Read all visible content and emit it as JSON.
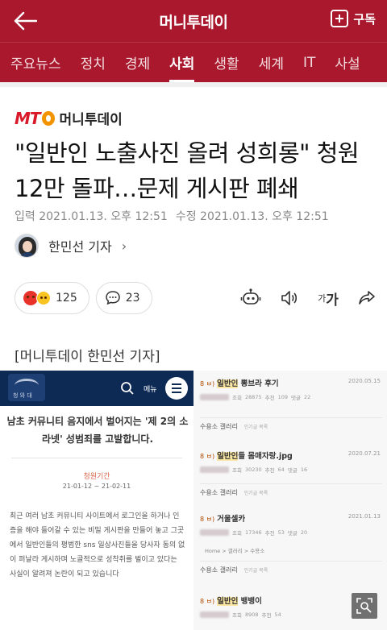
{
  "header": {
    "title": "머니투데이",
    "subscribe_label": "구독",
    "back_icon": "arrow-left-icon",
    "subscribe_icon": "plus-box-icon"
  },
  "nav": {
    "items": [
      {
        "label": "주요뉴스"
      },
      {
        "label": "정치"
      },
      {
        "label": "경제"
      },
      {
        "label": "사회"
      },
      {
        "label": "생활"
      },
      {
        "label": "세계"
      },
      {
        "label": "IT"
      },
      {
        "label": "사설"
      }
    ],
    "active": "사회"
  },
  "article": {
    "brand_mt": "MT",
    "brand_name": "머니투데이",
    "headline": "\"일반인 노출사진 올려 성희롱\" 청원 12만 돌파…문제 게시판 폐쇄",
    "published": "입력 2021.01.13. 오후 12:51",
    "updated": "수정 2021.01.13. 오후 12:51",
    "reporter": "한민선 기자",
    "reaction_count": "125",
    "comment_count": "23",
    "font_tool_small": "가",
    "font_tool_large": "가",
    "caption": "[머니투데이 한민선 기자]"
  },
  "photo": {
    "left": {
      "seal_label": "청 와 대",
      "menu_label": "메뉴",
      "title": "남초 커뮤니티 음지에서 벌어지는 '제 2의 소라넷' 성범죄를 고발합니다.",
      "period_label": "청원기간",
      "period_value": "21-01-12 ~ 21-02-11",
      "body": "최근 여러 남초 커뮤니티 사이트에서 로그인을 하거나 인증을 해야 들어갈 수 있는 비밀 게시판을 만들어 놓고 그곳에서 일반인들의 평범한 sns 일상사진들을 당사자 동의 없이 퍼날라 게시하며 노골적으로 성착취를 벌이고 있다는 사실이 알려져 논란이 되고 있습니다"
    },
    "right": {
      "posts": [
        {
          "tag": "8 ㅂ)",
          "title_pre": "",
          "title_hl": "일반인",
          "title_post": " 뽕브라 후기",
          "date": "2020.05.15",
          "views": "28875",
          "likes": "109",
          "comments": "22"
        },
        {
          "tag": "8 ㅂ)",
          "title_pre": "",
          "title_hl": "일반인",
          "title_post": "들 몸매자랑.jpg",
          "date": "2020.07.21",
          "views": "30230",
          "likes": "64",
          "comments": "16"
        },
        {
          "tag": "8 ㅂ)",
          "title_pre": "거울셀카",
          "title_hl": "",
          "title_post": "",
          "date": "2021.01.13",
          "views": "17346",
          "likes": "53",
          "comments": "20"
        },
        {
          "tag": "8 ㅂ)",
          "title_pre": "",
          "title_hl": "일반인",
          "title_post": " 뱅뱅이",
          "date": "",
          "views": "8908",
          "likes": "54",
          "comments": ""
        }
      ],
      "gallery_label": "수용소 갤러리",
      "gallery_btn": "인기글 목록",
      "crumbs": "Home > 갤러리 > 수용소"
    }
  },
  "zoom_icon": "zoom-image-icon"
}
